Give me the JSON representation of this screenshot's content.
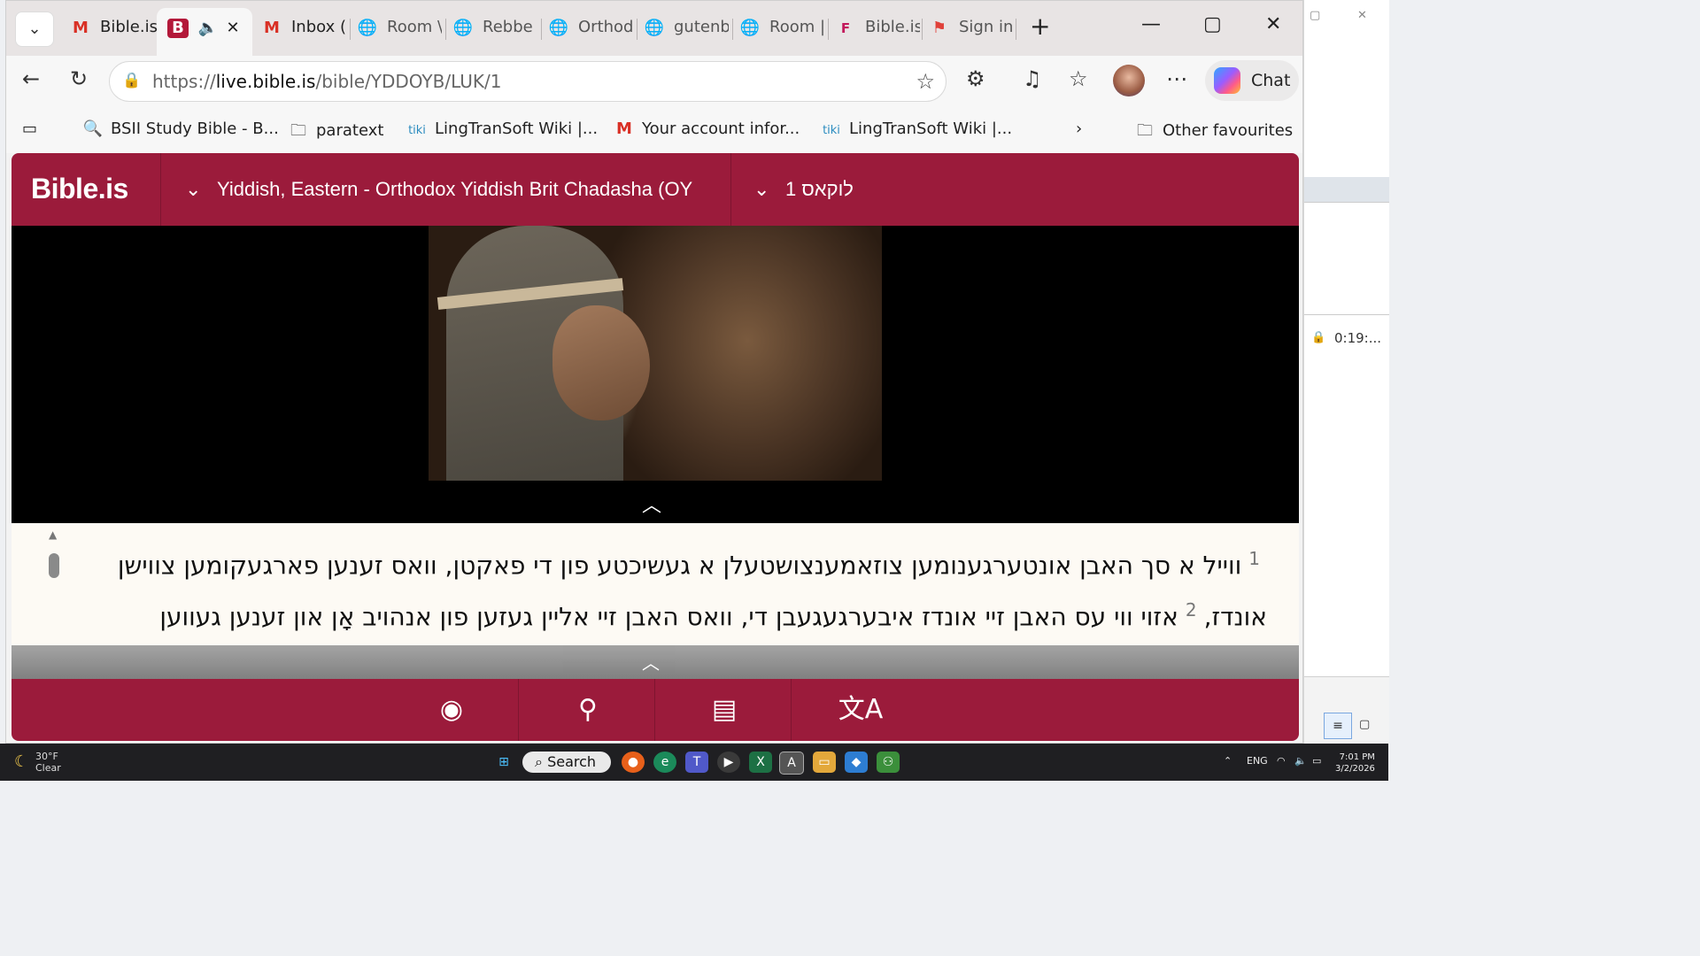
{
  "browser": {
    "tabs": [
      {
        "label": "Bible.is",
        "icon": "gmail-icon"
      },
      {
        "label": "",
        "icon": "bible-is-icon",
        "active": true
      },
      {
        "label": "Inbox (",
        "icon": "gmail-icon"
      },
      {
        "label": "Room \\",
        "icon": "globe-icon"
      },
      {
        "label": "Rebbe",
        "icon": "globe-icon"
      },
      {
        "label": "Orthod",
        "icon": "globe-icon"
      },
      {
        "label": "gutenb",
        "icon": "globe-icon"
      },
      {
        "label": "Room |",
        "icon": "globe-icon"
      },
      {
        "label": "Bible.is",
        "icon": "f-icon"
      },
      {
        "label": "Sign in",
        "icon": "flag-icon"
      }
    ],
    "url_host": "live.bible.is",
    "url_prefix": "https://",
    "url_path": "/bible/YDDOYB/LUK/1",
    "chat_label": "Chat",
    "favorites": [
      {
        "label": "BSII Study Bible - B...",
        "icon": "search-icon"
      },
      {
        "label": "paratext",
        "icon": "folder-icon"
      },
      {
        "label": "LingTranSoft Wiki |...",
        "icon": "tiki-icon"
      },
      {
        "label": "Your account infor...",
        "icon": "gmail-icon"
      },
      {
        "label": "LingTranSoft Wiki |...",
        "icon": "tiki-icon"
      }
    ],
    "other_favourites": "Other favourites"
  },
  "app": {
    "brand": "Bible.is",
    "version": "Yiddish, Eastern - Orthodox Yiddish Brit Chadasha (OY",
    "book": "לוקאס 1"
  },
  "verses": [
    {
      "num": "1",
      "text": "ווייל א סך האבן אונטערגענומען צוזאמענצושטעלן א געשיכטע פון די פאקטן, וואס זענען פארגעקומען צווישן"
    },
    {
      "num": "2",
      "pre": "אונדז,",
      "text": "אזוי ווי עס האבן זיי אונדז איבערגעגעבן די, וואס האבן זיי אליין געזען פון אנהויב אָן און זענען געווען"
    }
  ],
  "background_window": {
    "timer": "0:19:..."
  },
  "taskbar": {
    "weather_temp": "30°F",
    "weather_desc": "Clear",
    "search_label": "Search",
    "lang": "ENG",
    "time": "7:01 PM",
    "date": "3/2/2026"
  },
  "colors": {
    "brand": "#9b1b3b",
    "verse_bg": "#fdfaf4"
  }
}
